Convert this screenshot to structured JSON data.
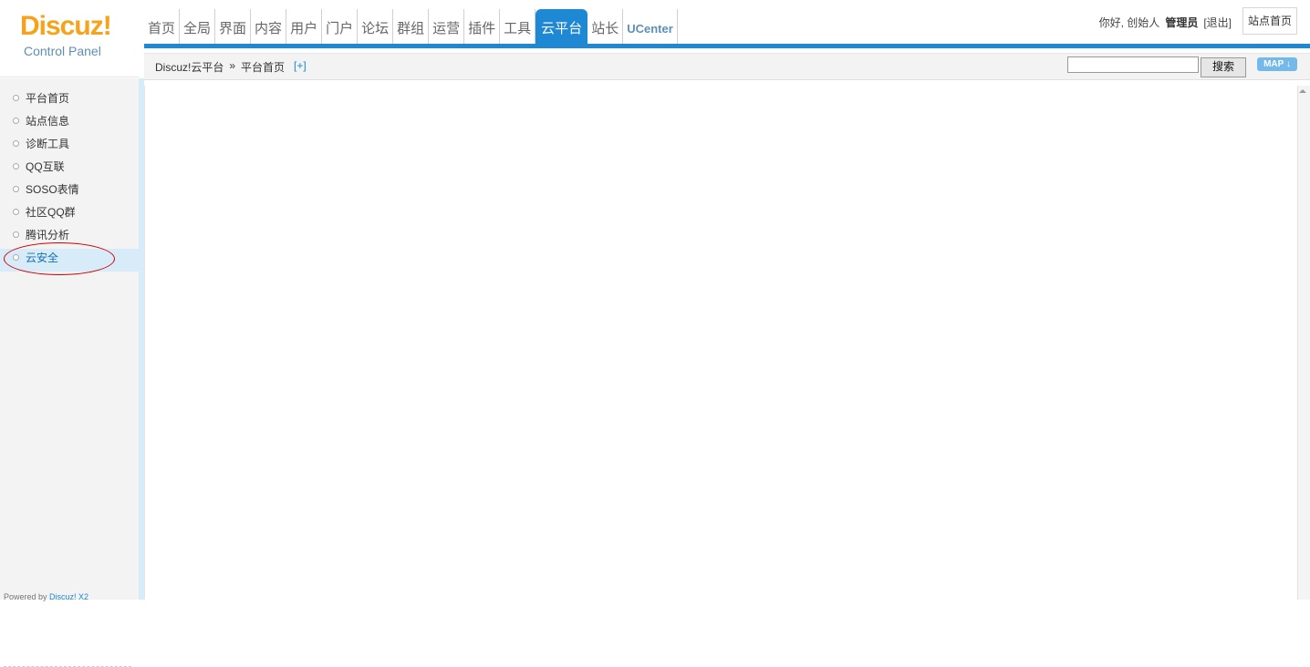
{
  "logo": {
    "main": "Discuz!",
    "sub": "Control Panel"
  },
  "nav": {
    "items": [
      {
        "label": "首页"
      },
      {
        "label": "全局"
      },
      {
        "label": "界面"
      },
      {
        "label": "内容"
      },
      {
        "label": "用户"
      },
      {
        "label": "门户"
      },
      {
        "label": "论坛"
      },
      {
        "label": "群组"
      },
      {
        "label": "运营"
      },
      {
        "label": "插件"
      },
      {
        "label": "工具"
      },
      {
        "label": "云平台"
      },
      {
        "label": "站长"
      },
      {
        "label": "UCenter"
      }
    ],
    "active": "云平台"
  },
  "user": {
    "greeting": "你好, 创始人",
    "name": "管理员",
    "logout": "[退出]",
    "site_home": "站点首页"
  },
  "breadcrumb": {
    "part1": "Discuz!云平台",
    "sep": "»",
    "part2": "平台首页",
    "add": "[+]"
  },
  "search": {
    "value": "",
    "button": "搜索"
  },
  "map_button": "MAP ↓",
  "sidebar": {
    "items": [
      {
        "label": "平台首页"
      },
      {
        "label": "站点信息"
      },
      {
        "label": "诊断工具"
      },
      {
        "label": "QQ互联"
      },
      {
        "label": "SOSO表情"
      },
      {
        "label": "社区QQ群"
      },
      {
        "label": "腾讯分析"
      },
      {
        "label": "云安全"
      }
    ],
    "active": "云安全"
  },
  "footer": {
    "prefix": "Powered by",
    "brand": "Discuz! X2"
  },
  "colors": {
    "accent": "#1e88d4",
    "logo_orange": "#f7a21a",
    "highlight": "#d8ebf8",
    "annotation": "#cc0000"
  }
}
